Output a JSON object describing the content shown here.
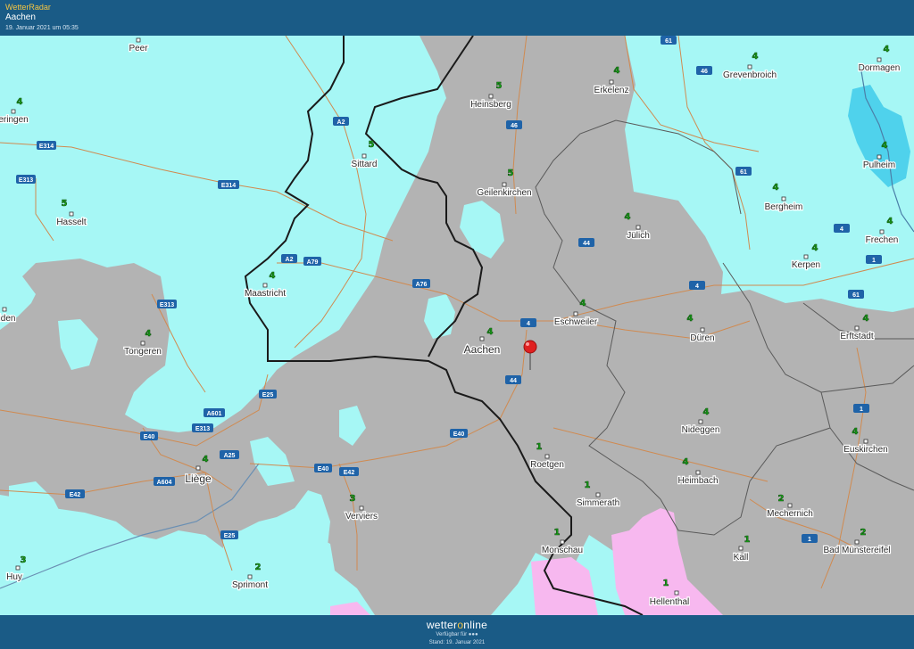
{
  "header": {
    "brand": "WetterRadar",
    "city": "Aachen",
    "timestamp": "19. Januar 2021 um 05:35"
  },
  "footer": {
    "logo_a": "wetter",
    "logo_o": "o",
    "logo_b": "nline",
    "available": "Verfügbar für ●●●",
    "stand": "Stand: 19. Januar 2021"
  },
  "colors": {
    "light_precip": "#a6f7f5",
    "no_precip": "#b3b3b3",
    "snow": "#f7b8ef",
    "heavy": "#4fd2ec",
    "header": "#1a5b86",
    "forecast_number": "#1aa51a",
    "pin": "#e02020"
  },
  "places": [
    {
      "name": "Peer",
      "fc": ""
    },
    {
      "name": "eringen",
      "fc": "4"
    },
    {
      "name": "Hasselt",
      "fc": "5"
    },
    {
      "name": "Heinsberg",
      "fc": "5"
    },
    {
      "name": "Erkelenz",
      "fc": "4"
    },
    {
      "name": "Grevenbroich",
      "fc": "4"
    },
    {
      "name": "Dormagen",
      "fc": "4"
    },
    {
      "name": "Sittard",
      "fc": "5"
    },
    {
      "name": "Geilenkirchen",
      "fc": "5"
    },
    {
      "name": "Pulheim",
      "fc": "4"
    },
    {
      "name": "Bergheim",
      "fc": "4"
    },
    {
      "name": "Jülich",
      "fc": "4"
    },
    {
      "name": "Frechen",
      "fc": "4"
    },
    {
      "name": "Kerpen",
      "fc": "4"
    },
    {
      "name": "Maastricht",
      "fc": "4"
    },
    {
      "name": "Eschweiler",
      "fc": "4"
    },
    {
      "name": "Düren",
      "fc": "4"
    },
    {
      "name": "Erftstadt",
      "fc": "4"
    },
    {
      "name": "Tongeren",
      "fc": "4"
    },
    {
      "name": "Aachen",
      "fc": "4"
    },
    {
      "name": "Nideggen",
      "fc": "4"
    },
    {
      "name": "Euskirchen",
      "fc": "4"
    },
    {
      "name": "Roetgen",
      "fc": "1"
    },
    {
      "name": "Heimbach",
      "fc": "4"
    },
    {
      "name": "Liège",
      "fc": "4"
    },
    {
      "name": "Simmerath",
      "fc": "1"
    },
    {
      "name": "Verviers",
      "fc": "3"
    },
    {
      "name": "Mechernich",
      "fc": "2"
    },
    {
      "name": "Monschau",
      "fc": "1"
    },
    {
      "name": "Kall",
      "fc": "1"
    },
    {
      "name": "Bad Münstereifel",
      "fc": "2"
    },
    {
      "name": "Huy",
      "fc": "3"
    },
    {
      "name": "Sprimont",
      "fc": "2"
    },
    {
      "name": "Hellenthal",
      "fc": "1"
    },
    {
      "name": "iden",
      "fc": ""
    }
  ],
  "roads": [
    "61",
    "46",
    "A2",
    "46",
    "E314",
    "E313",
    "E314",
    "61",
    "44",
    "4",
    "A2",
    "A79",
    "A76",
    "E313",
    "4",
    "1",
    "4",
    "61",
    "44",
    "E25",
    "A601",
    "E40",
    "E313",
    "A25",
    "E40",
    "E40",
    "E42",
    "A604",
    "E42",
    "1",
    "E25",
    "1"
  ]
}
